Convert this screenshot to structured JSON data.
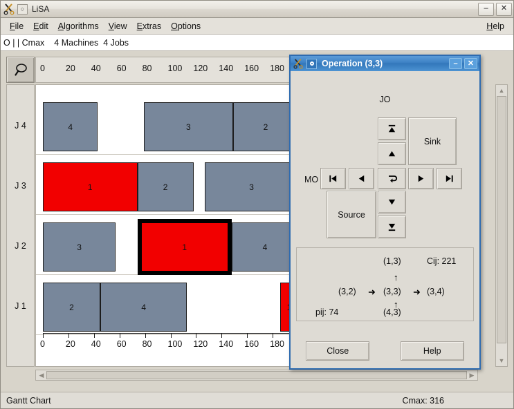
{
  "window": {
    "title": "LiSA",
    "app_icon": "scissors-icon",
    "minimize_label": "–",
    "close_label": "✕"
  },
  "menubar": {
    "items": [
      {
        "label": "File",
        "mnemonic": "F"
      },
      {
        "label": "Edit",
        "mnemonic": "E"
      },
      {
        "label": "Algorithms",
        "mnemonic": "A"
      },
      {
        "label": "View",
        "mnemonic": "V"
      },
      {
        "label": "Extras",
        "mnemonic": "E"
      },
      {
        "label": "Options",
        "mnemonic": "O"
      }
    ],
    "help": {
      "label": "Help",
      "mnemonic": "H"
    }
  },
  "problem_bar": {
    "notation": "O | | Cmax",
    "machines": "4 Machines",
    "jobs": "4 Jobs"
  },
  "toolbar": {
    "zoom_tool": "magnifier-icon"
  },
  "statusbar": {
    "left": "Gantt Chart",
    "right": "Cmax: 316"
  },
  "chart_data": {
    "type": "gantt",
    "title": "Gantt Chart",
    "xlabel": "",
    "ylabel": "",
    "xlim": [
      0,
      200
    ],
    "tick_values": [
      0,
      20,
      40,
      60,
      80,
      100,
      120,
      140,
      160,
      180
    ],
    "tick_labels": [
      "0",
      "20",
      "40",
      "60",
      "80",
      "100",
      "120",
      "140",
      "160",
      "180"
    ],
    "row_labels": [
      "J 4",
      "J 3",
      "J 2",
      "J 1"
    ],
    "cmax_marker": "316",
    "colors": {
      "normal": "#78879b",
      "highlight": "#f20000",
      "selected_border": "#000000"
    },
    "rows": [
      {
        "label": "J 4",
        "bars": [
          {
            "machine": "4",
            "start": 0,
            "end": 43,
            "color": "normal",
            "selected": false
          },
          {
            "machine": "3",
            "start": 79,
            "end": 149,
            "color": "normal",
            "selected": false
          },
          {
            "machine": "2",
            "start": 149,
            "end": 200,
            "color": "normal",
            "selected": false
          }
        ]
      },
      {
        "label": "J 3",
        "bars": [
          {
            "machine": "1",
            "start": 0,
            "end": 74,
            "color": "highlight",
            "selected": false
          },
          {
            "machine": "2",
            "start": 74,
            "end": 118,
            "color": "normal",
            "selected": false
          },
          {
            "machine": "3",
            "start": 127,
            "end": 200,
            "color": "normal",
            "selected": false
          }
        ]
      },
      {
        "label": "J 2",
        "bars": [
          {
            "machine": "3",
            "start": 0,
            "end": 57,
            "color": "normal",
            "selected": false
          },
          {
            "machine": "1",
            "start": 74,
            "end": 148,
            "color": "highlight",
            "selected": true
          },
          {
            "machine": "4",
            "start": 148,
            "end": 200,
            "color": "normal",
            "selected": false
          }
        ]
      },
      {
        "label": "J 1",
        "bars": [
          {
            "machine": "2",
            "start": 0,
            "end": 45,
            "color": "normal",
            "selected": false
          },
          {
            "machine": "4",
            "start": 45,
            "end": 113,
            "color": "normal",
            "selected": false
          },
          {
            "machine": "1",
            "start": 186,
            "end": 200,
            "color": "highlight",
            "selected": false
          }
        ]
      }
    ]
  },
  "dialog": {
    "title": "Operation (3,3)",
    "app_icon": "scissors-icon",
    "doc_icon": "gear-icon",
    "minimize_label": "–",
    "close_label": "✕",
    "jo_label": "JO",
    "mo_label": "MO",
    "nav": {
      "jo_first": "first-up-icon",
      "jo_prev": "up-icon",
      "jo_next": "down-icon",
      "jo_last": "last-down-icon",
      "mo_first": "skip-backward-icon",
      "mo_prev": "left-icon",
      "mo_center": "swap-arrow-icon",
      "mo_next": "right-icon",
      "mo_last": "skip-forward-icon",
      "sink_label": "Sink",
      "source_label": "Source"
    },
    "info": {
      "top": "(1,3)",
      "cij": "Cij: 221",
      "left": "(3,2)",
      "center": "(3,3)",
      "right": "(3,4)",
      "bottom": "(4,3)",
      "pij": "pij: 74",
      "arrow_up_1": "↑",
      "arrow_up_2": "↑",
      "arrow_right_1": "➜",
      "arrow_right_2": "➜"
    },
    "actions": {
      "close": "Close",
      "help": "Help"
    }
  }
}
